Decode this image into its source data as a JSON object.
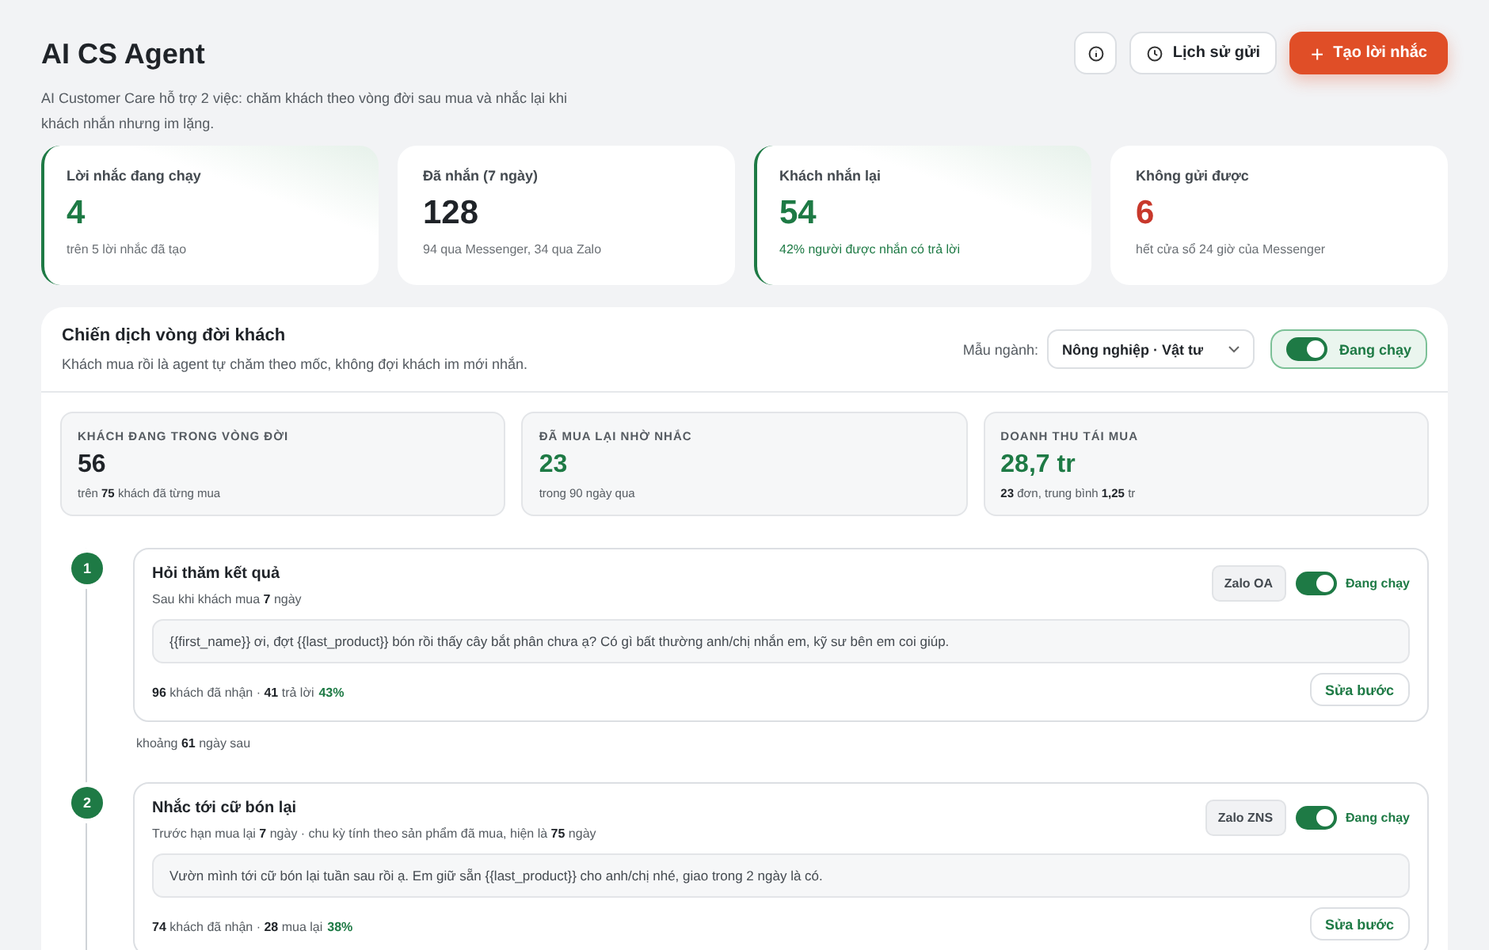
{
  "header": {
    "title": "AI CS Agent",
    "description": "AI Customer Care hỗ trợ 2 việc: chăm khách theo vòng đời sau mua và nhắc lại khi khách nhắn nhưng im lặng.",
    "history_button": "Lịch sử gửi",
    "create_button_icon": "+",
    "create_button": "Tạo lời nhắc"
  },
  "stats": [
    {
      "label": "Lời nhắc đang chạy",
      "value": "4",
      "note": "trên 5 lời nhắc đã tạo",
      "highlighted": true,
      "color": "#1e7a45",
      "note_highlighted": false
    },
    {
      "label": "Đã nhắn (7 ngày)",
      "value": "128",
      "note": "94 qua Messenger, 34 qua Zalo",
      "highlighted": false,
      "color": "#1f2328",
      "note_highlighted": false
    },
    {
      "label": "Khách nhắn lại",
      "value": "54",
      "note": "42% người được nhắn có trả lời",
      "highlighted": true,
      "color": "#1e7a45",
      "note_highlighted": true
    },
    {
      "label": "Không gửi được",
      "value": "6",
      "note": "hết cửa sổ 24 giờ của Messenger",
      "highlighted": false,
      "color": "#c8382b",
      "note_highlighted": false
    }
  ],
  "campaign": {
    "title": "Chiến dịch vòng đời khách",
    "description": "Khách mua rồi là agent tự chăm theo mốc, không đợi khách im mới nhắn.",
    "template_label": "Mẫu ngành:",
    "template_value": "Nông nghiệp · Vật tư",
    "running": {
      "on": true,
      "label": "Đang chạy"
    },
    "metrics": [
      {
        "label": "KHÁCH ĐANG TRONG VÒNG ĐỜI",
        "value": "56",
        "note": "trên **75** khách đã từng mua",
        "color": "#1f2328"
      },
      {
        "label": "ĐÃ MUA LẠI NHỜ NHẮC",
        "value": "23",
        "note": "trong 90 ngày qua",
        "color": "#1e7a45"
      },
      {
        "label": "DOANH THU TÁI MUA",
        "value": "28,7 tr",
        "note": "**23** đơn, trung bình **1,25** tr",
        "color": "#1e7a45"
      }
    ],
    "steps": [
      {
        "number": "1",
        "title": "Hỏi thăm kết quả",
        "timing": "Sau khi khách mua **7** ngày",
        "channel": "Zalo OA",
        "on": true,
        "status": "Đang chạy",
        "message": "{{first_name}} ơi, đợt {{last_product}} bón rồi thấy cây bắt phân chưa ạ? Có gì bất thường anh/chị nhắn em, kỹ sư bên em coi giúp.",
        "result": "**96** khách đã nhận · **41** trả lời",
        "rate": "43%",
        "edit_button": "Sửa bước",
        "gap": "khoảng **61** ngày sau"
      },
      {
        "number": "2",
        "title": "Nhắc tới cữ bón lại",
        "timing": "Trước hạn mua lại **7** ngày · chu kỳ tính theo sản phẩm đã mua, hiện là **75** ngày",
        "channel": "Zalo ZNS",
        "on": true,
        "status": "Đang chạy",
        "message": "Vườn mình tới cữ bón lại tuần sau rồi ạ. Em giữ sẵn {{last_product}} cho anh/chị nhé, giao trong 2 ngày là có.",
        "result": "**74** khách đã nhận · **28** mua lại",
        "rate": "38%",
        "edit_button": "Sửa bước"
      }
    ]
  }
}
